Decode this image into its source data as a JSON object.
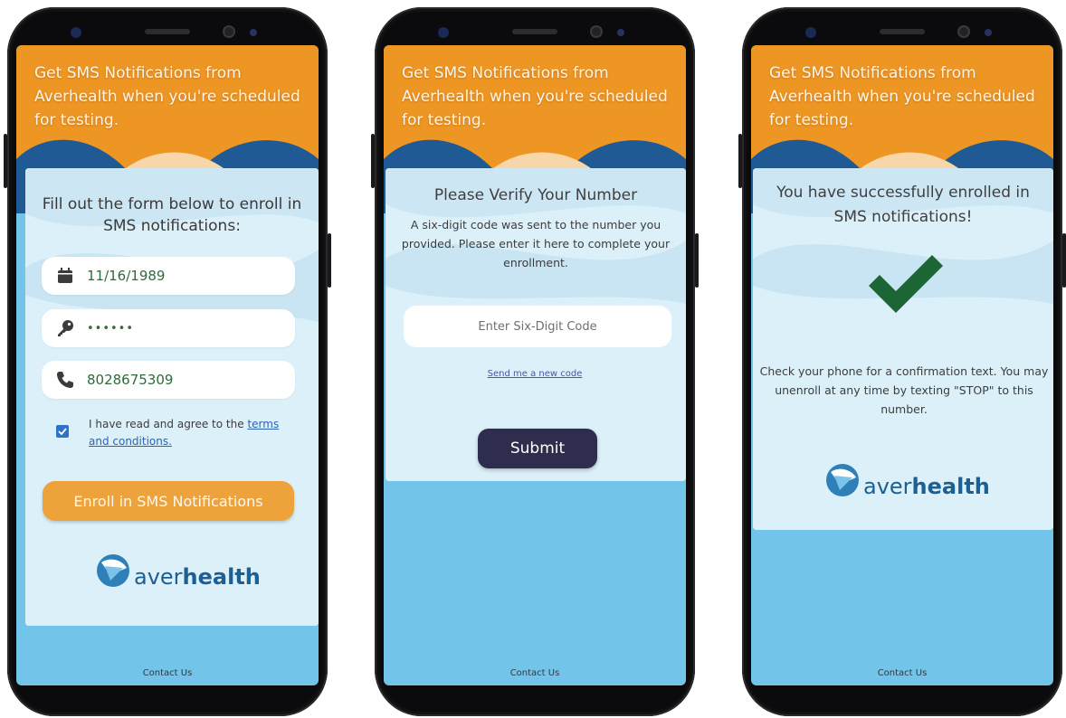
{
  "header_text": "Get SMS Notifications from Averhealth when you're scheduled for testing.",
  "footer_link": "Contact Us",
  "brand": {
    "name_light": "aver",
    "name_bold": "health",
    "color_blue": "#1c5f92",
    "color_orange": "#ee9624"
  },
  "screen1": {
    "title": "Fill out the form below to enroll in SMS notifications:",
    "dob_icon": "calendar-icon",
    "dob_value": "11/16/1989",
    "pin_icon": "key-icon",
    "pin_value": "••••••",
    "phone_icon": "phone-icon",
    "phone_value": "8028675309",
    "checkbox_checked": true,
    "agree_text": "I have read and agree to the ",
    "terms_link": "terms and conditions.",
    "enroll_button": "Enroll in SMS Notifications"
  },
  "screen2": {
    "title": "Please Verify Your Number",
    "description": "A six-digit code was sent to the number you provided. Please enter it here to complete your enrollment.",
    "code_placeholder": "Enter Six-Digit Code",
    "resend_link": "Send me a new code",
    "submit_button": "Submit"
  },
  "screen3": {
    "title": "You have successfully enrolled in SMS notifications!",
    "success_icon": "checkmark-icon",
    "description": "Check your phone for a confirmation text. You may unenroll at any time by texting \"STOP\" to this number."
  }
}
